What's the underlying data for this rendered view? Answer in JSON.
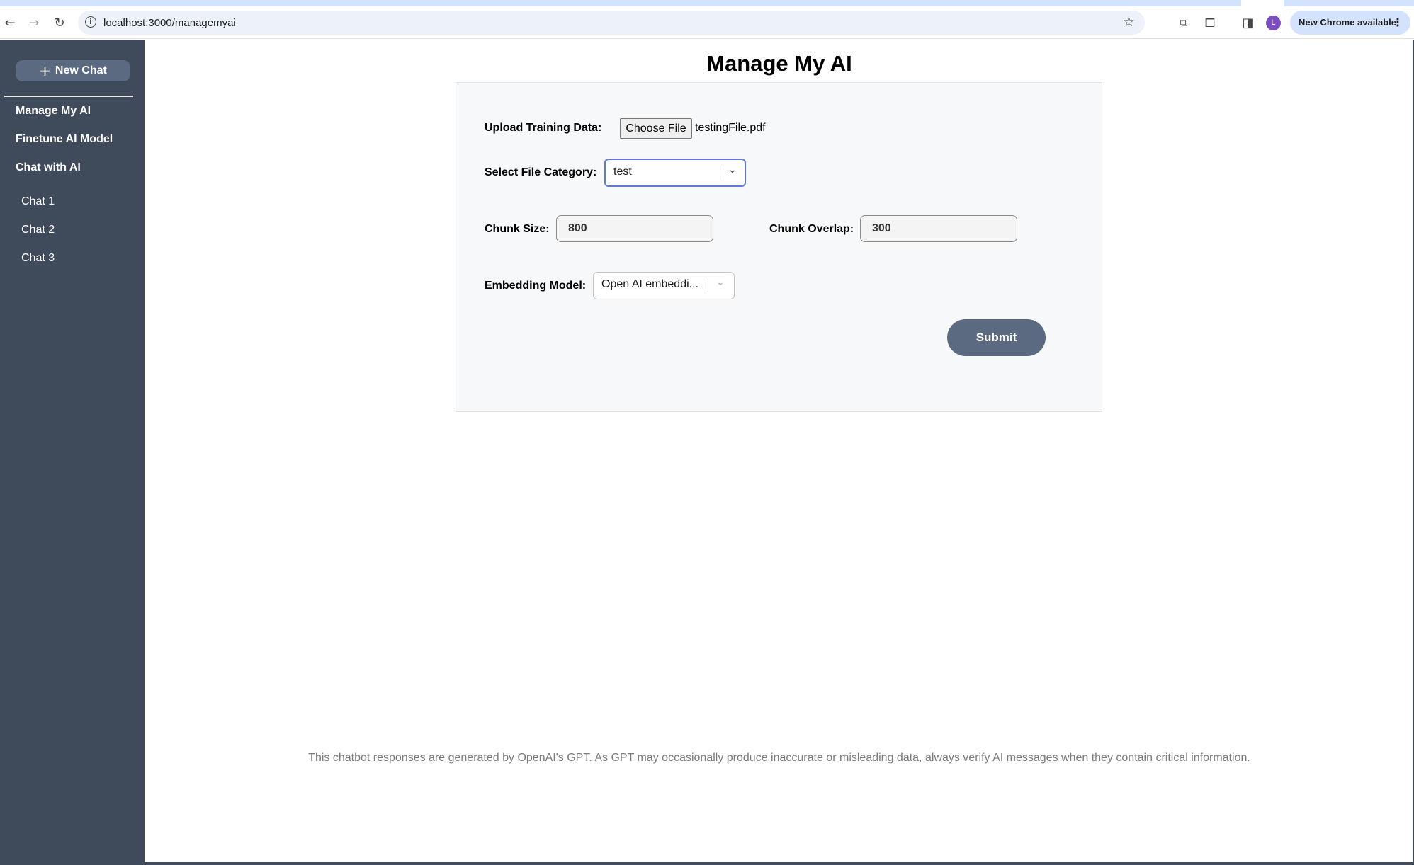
{
  "browser": {
    "url": "localhost:3000/managemyai",
    "update_label": "New Chrome available",
    "profile_initial": "L"
  },
  "sidebar": {
    "new_chat_label": "New Chat",
    "links": [
      "Manage My AI",
      "Finetune AI Model",
      "Chat with AI"
    ],
    "chats": [
      "Chat 1",
      "Chat 2",
      "Chat 3"
    ]
  },
  "main": {
    "title": "Manage My AI",
    "form": {
      "upload_label": "Upload Training Data:",
      "choose_file_label": "Choose File",
      "file_name": "testingFile.pdf",
      "category_label": "Select File Category:",
      "category_value": "test",
      "chunk_size_label": "Chunk Size:",
      "chunk_size_value": "800",
      "chunk_overlap_label": "Chunk Overlap:",
      "chunk_overlap_value": "300",
      "embedding_label": "Embedding Model:",
      "embedding_value": "Open AI embeddi...",
      "submit_label": "Submit"
    },
    "disclaimer": "This chatbot responses are generated by OpenAI's GPT. As GPT may occasionally produce inaccurate or misleading data, always verify AI messages when they contain critical information."
  },
  "colors": {
    "sidebar_bg": "#3f4a5b",
    "button_bg": "#5b6a80",
    "focus_border": "#5d7bd6"
  },
  "icons": [
    "back-arrow-icon",
    "forward-arrow-icon",
    "reload-icon",
    "site-info-icon",
    "bookmark-star-icon",
    "cast-icon",
    "extensions-icon",
    "side-panel-icon",
    "more-icon",
    "plus-icon",
    "chevron-down-icon"
  ]
}
